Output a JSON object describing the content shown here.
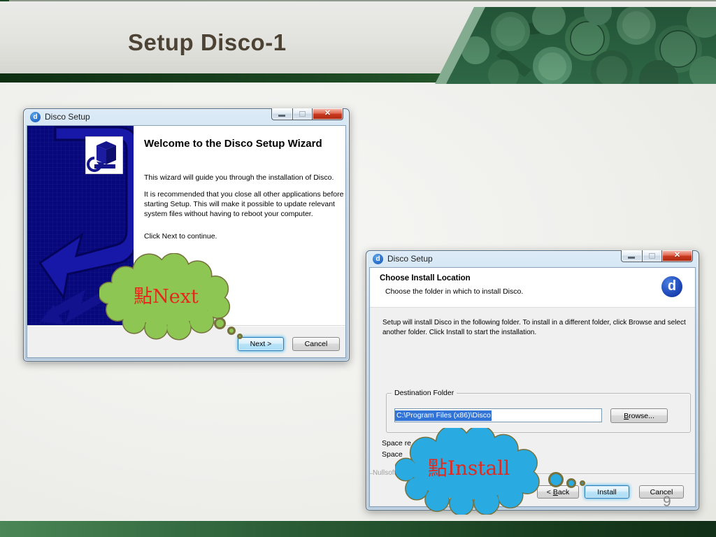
{
  "slide": {
    "title": "Setup Disco-1",
    "page_number": "9"
  },
  "colors": {
    "green_cloud": "#8dc653",
    "blue_cloud": "#29aae1",
    "callout_text": "#e5281c",
    "header_bar_green": "#1c4722",
    "wizard_panel_blue": "#08087d",
    "close_button_red": "#cb3a20"
  },
  "dialog1": {
    "title": "Disco Setup",
    "heading": "Welcome to the Disco Setup Wizard",
    "para1": "This wizard will guide you through the installation of Disco.",
    "para2": "It is recommended that you close all other applications before starting Setup. This will make it possible to update relevant system files without having to reboot your computer.",
    "para3": "Click Next to continue.",
    "next_button": "Next >",
    "cancel_button": "Cancel"
  },
  "dialog2": {
    "title": "Disco Setup",
    "heading": "Choose Install Location",
    "subheading": "Choose the folder in which to install Disco.",
    "body": "Setup will install Disco in the following folder. To install in a different folder, click Browse and select another folder. Click Install to start the installation.",
    "group_label": "Destination Folder",
    "folder_value": "C:\\Program Files (x86)\\Disco",
    "browse_key": "B",
    "browse_rest": "rowse...",
    "space_required_fragment": "Space re",
    "space_available_fragment": "Space",
    "brand_fragment": "Nullsoft I",
    "back_prefix": "< ",
    "back_key": "B",
    "back_rest": "ack",
    "install_button": "Install",
    "cancel_button": "Cancel"
  },
  "callouts": {
    "next_label": "點Next",
    "install_label": "點Install"
  }
}
